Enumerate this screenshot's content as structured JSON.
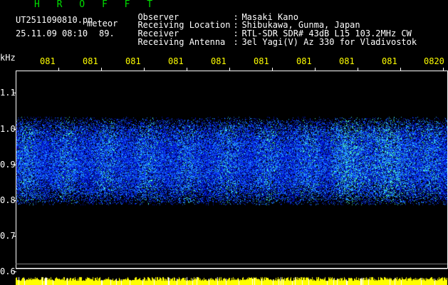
{
  "header": {
    "app_name": "H R O F F T",
    "filename": "UT2511090810.pn",
    "tag": "meteor",
    "datetime": "25.11.09 08:10",
    "count": "89.",
    "info": [
      {
        "key": "Observer",
        "value": "Masaki Kano"
      },
      {
        "key": "Receiving Location",
        "value": "Shibukawa, Gunma, Japan"
      },
      {
        "key": "Receiver",
        "value": "RTL-SDR SDR# 43dB L15 103.2MHz CW"
      },
      {
        "key": "Receiving Antenna",
        "value": "3el Yagi(V) Az 330 for Vladivostok"
      }
    ]
  },
  "axes": {
    "y_unit": "kHz",
    "y_ticks": [
      "1.1",
      "1.0",
      "0.9",
      "0.8",
      "0.7",
      "0.6"
    ],
    "x_ticks": [
      "081",
      "081",
      "081",
      "081",
      "081",
      "081",
      "081",
      "081",
      "081",
      "0820"
    ]
  },
  "colors": {
    "title": "#00e000",
    "info_text": "#ffffff",
    "time_labels": "#ffff00",
    "signal_low": "#0000c0",
    "signal_high": "#00ffff",
    "meteor_strip": "#ffff00"
  },
  "band": {
    "freq_low_khz": 0.78,
    "freq_high_khz": 1.03
  }
}
